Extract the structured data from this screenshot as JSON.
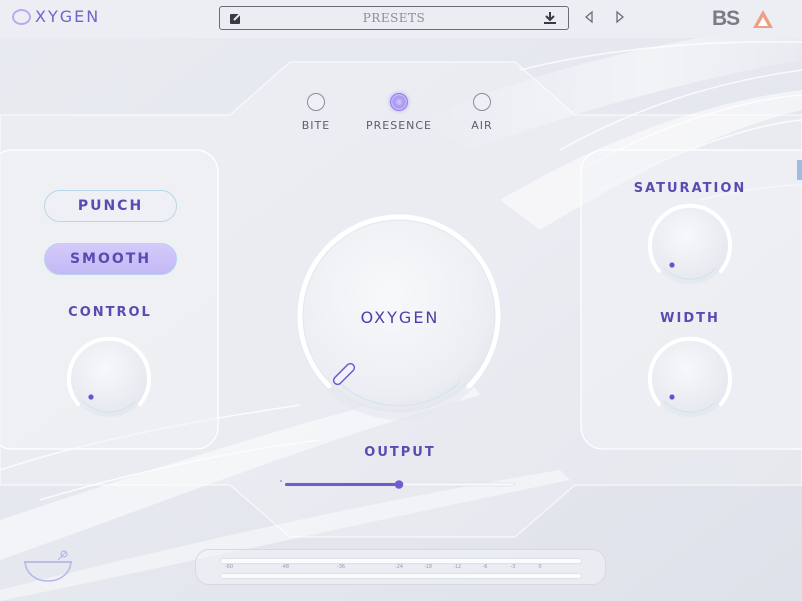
{
  "header": {
    "logo_text": "XYGEN",
    "preset_label": "PRESETS",
    "brand": "BS"
  },
  "bands": [
    {
      "label": "BITE",
      "active": false
    },
    {
      "label": "PRESENCE",
      "active": true
    },
    {
      "label": "AIR",
      "active": false
    }
  ],
  "left_panel": {
    "punch_label": "PUNCH",
    "smooth_label": "SMOOTH",
    "control_label": "CONTROL"
  },
  "center": {
    "main_knob_label": "OXYGEN",
    "output_label": "OUTPUT",
    "output_value": 0.5
  },
  "right_panel": {
    "saturation_label": "SATURATION",
    "width_label": "WIDTH"
  },
  "meter": {
    "ticks": [
      "-60",
      "-48",
      "-36",
      "-24",
      "-18",
      "-12",
      "-6",
      "-3",
      "0"
    ]
  },
  "colors": {
    "accent": "#6b5fd0",
    "label": "#5a4bb2",
    "active_pill": "#c6bbf6"
  }
}
